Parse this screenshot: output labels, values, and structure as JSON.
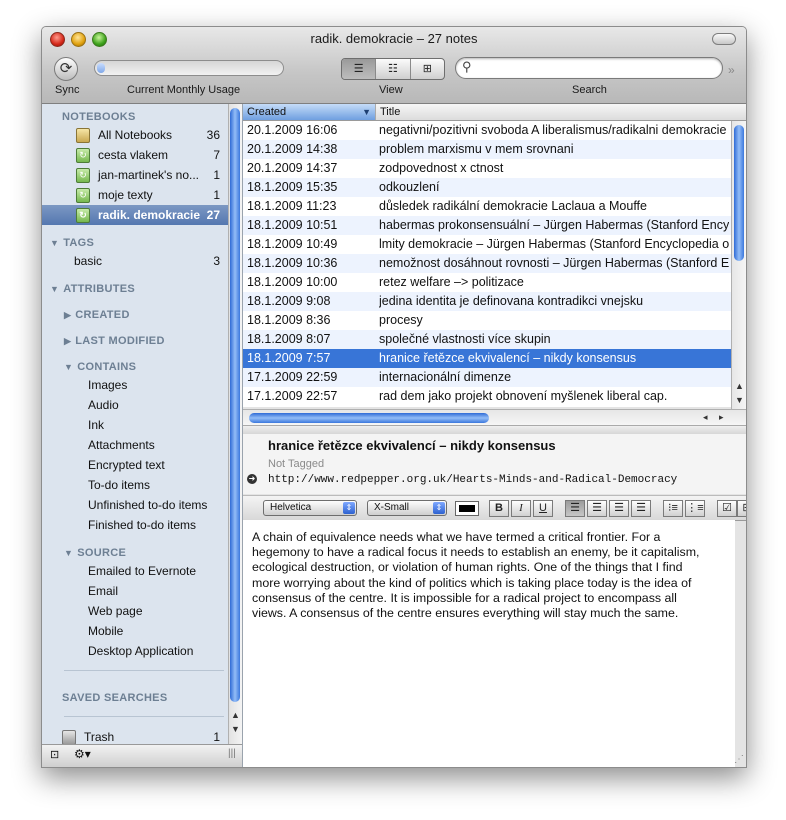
{
  "window": {
    "title": "radik. demokracie – 27 notes"
  },
  "toolbar": {
    "sync_label": "Sync",
    "usage_label": "Current Monthly Usage",
    "usage_fraction": 0.04,
    "view_label": "View",
    "search_label": "Search",
    "search_value": "",
    "view_modes": [
      "list-view-icon",
      "snippet-view-icon",
      "thumbnail-view-icon"
    ],
    "active_view": 0
  },
  "sidebar": {
    "notebooks_header": "NOTEBOOKS",
    "notebooks": [
      {
        "label": "All Notebooks",
        "count": "36",
        "icon": "all-notebooks-icon"
      },
      {
        "label": "cesta vlakem",
        "count": "7",
        "icon": "notebook-icon"
      },
      {
        "label": "jan-martinek's no...",
        "count": "1",
        "icon": "notebook-icon"
      },
      {
        "label": "moje texty",
        "count": "1",
        "icon": "notebook-icon"
      },
      {
        "label": "radik. demokracie",
        "count": "27",
        "icon": "notebook-icon",
        "selected": true
      }
    ],
    "tags_header": "TAGS",
    "tags": [
      {
        "label": "basic",
        "count": "3"
      }
    ],
    "attributes_header": "ATTRIBUTES",
    "created_label": "CREATED",
    "last_modified_label": "LAST MODIFIED",
    "contains_label": "CONTAINS",
    "contains_items": [
      "Images",
      "Audio",
      "Ink",
      "Attachments",
      "Encrypted text",
      "To-do items",
      "Unfinished to-do items",
      "Finished to-do items"
    ],
    "source_label": "SOURCE",
    "source_items": [
      "Emailed to Evernote",
      "Email",
      "Web page",
      "Mobile",
      "Desktop Application"
    ],
    "saved_searches_header": "SAVED SEARCHES",
    "trash_label": "Trash",
    "trash_count": "1"
  },
  "list": {
    "columns": [
      "Created",
      "Title"
    ],
    "rows": [
      {
        "created": "20.1.2009 16:06",
        "title": "negativni/pozitivni svoboda A liberalismus/radikalni demokracie"
      },
      {
        "created": "20.1.2009 14:38",
        "title": "problem marxismu v mem srovnani"
      },
      {
        "created": "20.1.2009 14:37",
        "title": "zodpovednost x ctnost"
      },
      {
        "created": "18.1.2009 15:35",
        "title": "odkouzlení"
      },
      {
        "created": "18.1.2009 11:23",
        "title": "důsledek radikální demokracie Laclaua a Mouffe"
      },
      {
        "created": "18.1.2009 10:51",
        "title": "habermas prokonsensuální – Jürgen Habermas (Stanford Encyclopedia of Philosophy)"
      },
      {
        "created": "18.1.2009 10:49",
        "title": "lmity demokracie – Jürgen Habermas (Stanford Encyclopedia of Philosophy)"
      },
      {
        "created": "18.1.2009 10:36",
        "title": "nemožnost dosáhnout rovnosti – Jürgen Habermas (Stanford Encyclopedia)"
      },
      {
        "created": "18.1.2009 10:00",
        "title": "retez welfare –> politizace"
      },
      {
        "created": "18.1.2009 9:08",
        "title": "jedina identita je definovana kontradikci vnejsku"
      },
      {
        "created": "18.1.2009 8:36",
        "title": "procesy"
      },
      {
        "created": "18.1.2009 8:07",
        "title": "společné vlastnosti více skupin"
      },
      {
        "created": "18.1.2009 7:57",
        "title": "hranice řetězce ekvivalencí – nikdy konsensus",
        "selected": true
      },
      {
        "created": "17.1.2009 22:59",
        "title": "internacionální dimenze"
      },
      {
        "created": "17.1.2009 22:57",
        "title": "rad dem jako projekt obnovení myšlenek liberal cap."
      }
    ]
  },
  "note": {
    "title": "hranice řetězce ekvivalencí – nikdy konsensus",
    "tags": "Not Tagged",
    "url": "http://www.redpepper.org.uk/Hearts-Minds-and-Radical-Democracy",
    "font": "Helvetica",
    "size": "X-Small",
    "body_lines": [
      "A chain of equivalence needs what we have termed a critical frontier. For a",
      "hegemony to have a radical focus it needs to establish an enemy, be it capitalism,",
      "ecological destruction, or violation of human rights. One of the things that I find",
      "more worrying about the kind of politics which is taking place today is the idea of",
      "consensus of the centre. It is impossible for a radical project to encompass all",
      "views. A consensus of the centre ensures everything will stay much the same."
    ]
  },
  "format_bar": {
    "bold": "B",
    "italic": "I",
    "underline": "U",
    "align_icons": [
      "align-left-icon",
      "align-center-icon",
      "align-right-icon",
      "align-justify-icon"
    ],
    "list_icons": [
      "bullet-list-icon",
      "numbered-list-icon",
      "checkbox-icon"
    ]
  }
}
